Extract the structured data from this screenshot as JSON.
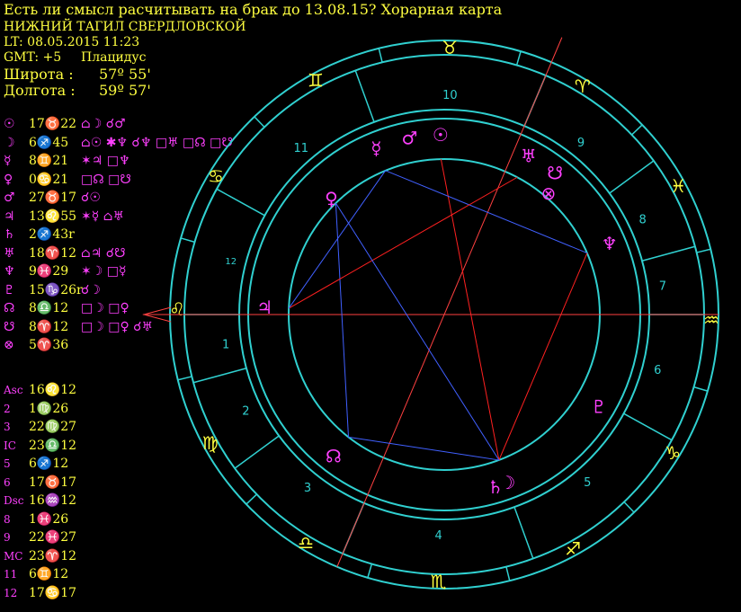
{
  "header": {
    "title": "Есть ли смысл расчитывать на брак до 13.08.15? Хорарная карта",
    "place": "НИЖНИЙ ТАГИЛ СВЕРДЛОВСКОЙ",
    "lt": "LT: 08.05.2015  11:23",
    "gmt_label": "GMT: +5",
    "house_system": "Плацидус",
    "lat_label": "Широта :",
    "lat_value": "57º 55'",
    "lon_label": "Долгота :",
    "lon_value": "59º 57'"
  },
  "planets": [
    {
      "name": "sun",
      "symbol": "☉",
      "pos": "17♉22",
      "aspects": "⌂☽ ☌♂"
    },
    {
      "name": "moon",
      "symbol": "☽",
      "pos": "6♐45",
      "aspects": "⌂☉ ✱♆ ☌♆ □♅ □☊ □☋"
    },
    {
      "name": "mercury",
      "symbol": "☿",
      "pos": "8♊21",
      "aspects": "✶♃ □♆"
    },
    {
      "name": "venus",
      "symbol": "♀",
      "pos": "0♋21",
      "aspects": "□☊ □☋"
    },
    {
      "name": "mars",
      "symbol": "♂",
      "pos": "27♉17",
      "aspects": "☌☉"
    },
    {
      "name": "jupiter",
      "symbol": "♃",
      "pos": "13♌55",
      "aspects": "✶☿ ⌂♅"
    },
    {
      "name": "saturn",
      "symbol": "♄",
      "pos": "2♐43r",
      "aspects": ""
    },
    {
      "name": "uranus",
      "symbol": "♅",
      "pos": "18♈12",
      "aspects": "⌂♃ ☌☋"
    },
    {
      "name": "neptune",
      "symbol": "♆",
      "pos": "9♓29",
      "aspects": "✶☽ □☿"
    },
    {
      "name": "pluto",
      "symbol": "♇",
      "pos": "15♑26r",
      "aspects": "☌☽"
    },
    {
      "name": "north-node",
      "symbol": "☊",
      "pos": "8♎12",
      "aspects": "□☽ □♀"
    },
    {
      "name": "south-node",
      "symbol": "☋",
      "pos": "8♈12",
      "aspects": "□☽ □♀ ☌♅"
    },
    {
      "name": "fortune",
      "symbol": "⊗",
      "pos": "5♈36",
      "aspects": ""
    }
  ],
  "houses": [
    {
      "name": "Asc",
      "pos": "16♌12"
    },
    {
      "name": "2",
      "pos": "1♍26"
    },
    {
      "name": "3",
      "pos": "22♍27"
    },
    {
      "name": "IC",
      "pos": "23♎12"
    },
    {
      "name": "5",
      "pos": "6♐12"
    },
    {
      "name": "6",
      "pos": "17♉17"
    },
    {
      "name": "Dsc",
      "pos": "16♒12"
    },
    {
      "name": "8",
      "pos": "1♓26"
    },
    {
      "name": "9",
      "pos": "22♓27"
    },
    {
      "name": "MC",
      "pos": "23♈12"
    },
    {
      "name": "11",
      "pos": "6♊12"
    },
    {
      "name": "12",
      "pos": "17♋17"
    }
  ],
  "wheel": {
    "zodiac_signs": [
      {
        "name": "taurus",
        "glyph": "♉",
        "color": "#ffff40"
      },
      {
        "name": "aries",
        "glyph": "♈",
        "color": "#ffff40"
      },
      {
        "name": "pisces",
        "glyph": "♓",
        "color": "#ffff40"
      },
      {
        "name": "aquarius",
        "glyph": "♒",
        "color": "#ffff40"
      },
      {
        "name": "capricorn",
        "glyph": "♑",
        "color": "#ffff40"
      },
      {
        "name": "sagittarius",
        "glyph": "♐",
        "color": "#ffff40"
      },
      {
        "name": "scorpio",
        "glyph": "♏",
        "color": "#ffff40"
      },
      {
        "name": "libra",
        "glyph": "♎",
        "color": "#ffff40"
      },
      {
        "name": "virgo",
        "glyph": "♍",
        "color": "#ffff40"
      },
      {
        "name": "leo",
        "glyph": "♌",
        "color": "#ffff40"
      },
      {
        "name": "cancer",
        "glyph": "♋",
        "color": "#ffff40"
      },
      {
        "name": "gemini",
        "glyph": "♊",
        "color": "#ffff40"
      }
    ],
    "house_numbers": [
      "10",
      "9",
      "8",
      "7",
      "6",
      "5",
      "4",
      "3",
      "2",
      "1",
      "12",
      "11"
    ],
    "planet_glyphs": [
      {
        "name": "sun",
        "glyph": "☉"
      },
      {
        "name": "mars",
        "glyph": "♂"
      },
      {
        "name": "mercury",
        "glyph": "☿"
      },
      {
        "name": "venus",
        "glyph": "♀"
      },
      {
        "name": "uranus",
        "glyph": "♅"
      },
      {
        "name": "south-node",
        "glyph": "☋"
      },
      {
        "name": "fortune",
        "glyph": "⊗"
      },
      {
        "name": "neptune",
        "glyph": "♆"
      },
      {
        "name": "north-node",
        "glyph": "☊"
      },
      {
        "name": "moon",
        "glyph": "☽"
      },
      {
        "name": "saturn",
        "glyph": "♄"
      },
      {
        "name": "jupiter",
        "glyph": "♃"
      },
      {
        "name": "pluto",
        "glyph": "♇"
      }
    ],
    "colors": {
      "ring": "#30d0d0",
      "planet": "#ff40ff",
      "sign": "#ffff40",
      "house_num": "#30d0d0",
      "aspect_red": "#ff2020",
      "aspect_blue": "#4060ff",
      "axis": "#ff4040"
    }
  }
}
